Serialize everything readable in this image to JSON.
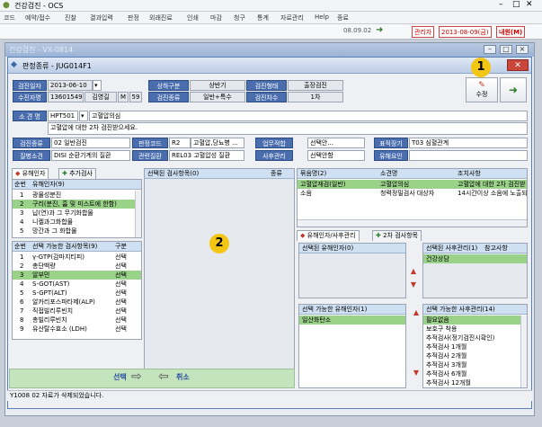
{
  "app": {
    "title": "건강검진 - OCS"
  },
  "menu": [
    "코드",
    "예약/접수",
    "진찰",
    "결과입력",
    "판정",
    "외래진료",
    "인쇄",
    "마감",
    "청구",
    "통계",
    "자료관리",
    "Help",
    "종료"
  ],
  "toolbar": {
    "code": "08.09.02",
    "user": "관리자",
    "date": "2013-08-09(금)",
    "myinfo": "내원(M)"
  },
  "child": {
    "title": "건강검진 - VX-0814"
  },
  "dialog": {
    "title": "판정종류 - JUG014F1",
    "save_label": "수정"
  },
  "header": {
    "checkup_date_label": "검진일자",
    "checkup_date": "2013-06-10",
    "half_label": "상하구분",
    "half": "상반기",
    "form_label": "검진형태",
    "form": "출장검진",
    "patient_no_label": "수진자명",
    "patient_no": "13601549",
    "patient_name": "김영길",
    "sex": "M",
    "age": "59",
    "type_label": "검진종류",
    "type": "일반+특수",
    "round_label": "검진차수",
    "round": "1차"
  },
  "finding": {
    "label": "소 견 명",
    "code": "HPT501",
    "name": "고혈압의심",
    "text": "고혈압에 대한 2차 검진받으세요."
  },
  "cond": {
    "type_label": "검진종류",
    "type": "02 일반검진",
    "code_label": "판정코드",
    "code_code": "R2",
    "code_val": "고혈압,당뇨병 ...",
    "work_label": "업무적합",
    "work_val": "선택안...",
    "disease_label": "표적장기",
    "disease_val": "T03 심혈관계",
    "env_label": "질병소견",
    "env_val": "DISI 순환기계의 질환",
    "rel_label": "관련질환",
    "rel_val": "REL03 고혈압성 질환",
    "post_label": "사후관리",
    "post_val": "선택안함",
    "cause_label": "유해요인"
  },
  "left_tabs": {
    "t1": "유해인자",
    "t2": "추가검사"
  },
  "hazard": {
    "headers": [
      "순번",
      "유해인자(9)"
    ],
    "rows": [
      [
        "1",
        "광물성분진"
      ],
      [
        "2",
        "구리(분진, 흄 및 미스트에 한함)"
      ],
      [
        "3",
        "납(연)과 그 무기화합물"
      ],
      [
        "4",
        "니켈과그화합물"
      ],
      [
        "5",
        "망간과 그 화합물"
      ]
    ]
  },
  "avail": {
    "headers": [
      "순번",
      "선택 가능한 검사항목(9)",
      "구분"
    ],
    "rows": [
      [
        "1",
        "γ-GTP(감마지티피)",
        "선택"
      ],
      [
        "2",
        "총단백량",
        "선택"
      ],
      [
        "3",
        "알부민",
        "선택"
      ],
      [
        "4",
        "S-GOT(AST)",
        "선택"
      ],
      [
        "5",
        "S-GPT(ALT)",
        "선택"
      ],
      [
        "6",
        "알카리포스파타제(ALP)",
        "선택"
      ],
      [
        "7",
        "직접빌리루빈치",
        "선택"
      ],
      [
        "8",
        "총빌리루빈치",
        "선택"
      ],
      [
        "9",
        "유산탈수효소 (LDH)",
        "선택"
      ]
    ]
  },
  "selected": {
    "headers": [
      "선택된 검사항목(0)",
      "종류"
    ]
  },
  "right_grid": {
    "headers": [
      "묶음명(2)",
      "소견명",
      "조치사항"
    ],
    "rows": [
      [
        "고혈압재검(일반)",
        "고혈압의심",
        "고혈압에 대한 2차 검진받"
      ],
      [
        "소음",
        "청력정밀검사 대상자",
        "14시간이상 소음에 노출되"
      ]
    ]
  },
  "right_tabs": {
    "t1": "유해인자/사후관리",
    "t2": "2차 검사항목"
  },
  "sel_hazard": {
    "header": "선택된 유해인자(0)"
  },
  "avail_hazard": {
    "header": "선택 가능한 유해인자(1)",
    "rows": [
      "일산화탄소"
    ]
  },
  "sel_post": {
    "headers": [
      "선택된 사후관리(1)",
      "참고사항"
    ],
    "rows": [
      "건강상담"
    ]
  },
  "avail_post": {
    "header": "선택 가능한 사후관리(14)",
    "rows": [
      "필요없음",
      "보호구 착용",
      "추적검사(정기검진시확인)",
      "추적검사 1개월",
      "추적검사 2개월",
      "추적검사 3개월",
      "추적검사 6개월",
      "추적검사 12개월"
    ]
  },
  "bottom": {
    "select_label": "선택",
    "cancel_label": "취소",
    "status": "Y1008 02 자료가 삭제되었습니다."
  },
  "badges": {
    "b1": "1",
    "b2": "2"
  }
}
